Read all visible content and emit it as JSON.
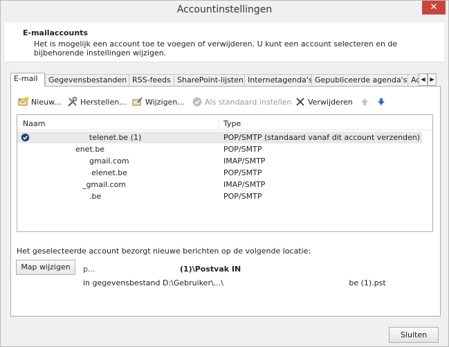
{
  "window": {
    "title": "Accountinstellingen",
    "close_glyph": "✕"
  },
  "header": {
    "title": "E-mailaccounts",
    "description": "Het is mogelijk een account toe te voegen of verwijderen. U kunt een account selecteren en de bijbehorende instellingen wijzigen."
  },
  "tabs": [
    {
      "label": "E-mail"
    },
    {
      "label": "Gegevensbestanden"
    },
    {
      "label": "RSS-feeds"
    },
    {
      "label": "SharePoint-lijsten"
    },
    {
      "label": "Internetagenda's"
    },
    {
      "label": "Gepubliceerde agenda's"
    },
    {
      "label": "Ad"
    }
  ],
  "toolbar": {
    "new": "Nieuw...",
    "repair": "Herstellen...",
    "change": "Wijzigen...",
    "set_default": "Als standaard instellen",
    "remove": "Verwijderen"
  },
  "list": {
    "col_name": "Naam",
    "col_type": "Type",
    "rows": [
      {
        "name": "telenet.be (1)",
        "type": "POP/SMTP (standaard vanaf dit account verzenden)"
      },
      {
        "name": "enet.be",
        "type": "POP/SMTP"
      },
      {
        "name": "gmail.com",
        "type": "IMAP/SMTP"
      },
      {
        "name": "elenet.be",
        "type": "POP/SMTP"
      },
      {
        "name": "_gmail.com",
        "type": "IMAP/SMTP"
      },
      {
        "name": ".be",
        "type": "POP/SMTP"
      }
    ]
  },
  "location": {
    "label": "Het geselecteerde account bezorgt nieuwe berichten op de volgende locatie:",
    "change_button": "Map wijzigen",
    "prefix": "p...",
    "folder": "(1)\\Postvak IN",
    "file": "in gegevensbestand D:\\Gebruiker\\...\\",
    "file_suffix": "be (1).pst"
  },
  "footer": {
    "close_button": "Sluiten"
  },
  "colors": {
    "close_red": "#c7463c",
    "selected_row": "#e8e8e8",
    "arrow_blue": "#2a6fd6"
  }
}
